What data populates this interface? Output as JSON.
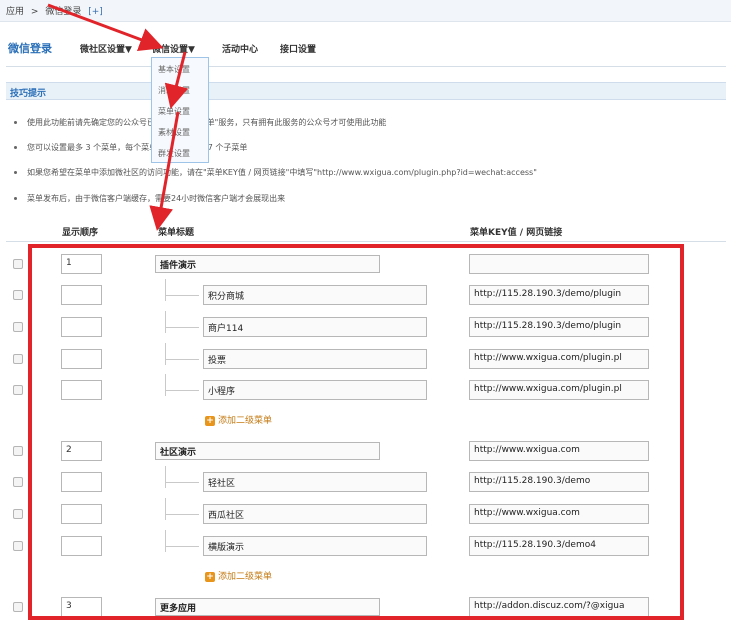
{
  "breadcrumb": {
    "part1": "应用",
    "sep": ">",
    "part2": "微信登录",
    "plus": "[+]"
  },
  "nav": {
    "brand": "微信登录",
    "items": [
      "微社区设置▼",
      "微信设置▼",
      "活动中心",
      "接口设置"
    ]
  },
  "dropdown": {
    "items": [
      "基本设置",
      "消息设置",
      "菜单设置",
      "素材设置",
      "群发设置"
    ]
  },
  "tips": {
    "title": "技巧提示",
    "lines": [
      "使用此功能前请先确定您的公众号已拥有\"自定义菜单\"服务，只有拥有此服务的公众号才可使用此功能",
      "您可以设置最多 3 个菜单，每个菜单可以创建最多 7 个子菜单",
      "如果您希望在菜单中添加微社区的访问功能，请在\"菜单KEY值 / 网页链接\"中填写\"http://www.wxigua.com/plugin.php?id=wechat:access\"",
      "菜单发布后，由于微信客户端缓存，需要24小时微信客户端才会展现出来"
    ]
  },
  "table": {
    "headers": {
      "order": "显示顺序",
      "title": "菜单标题",
      "key": "菜单KEY值 / 网页链接"
    },
    "rows": [
      {
        "type": "main",
        "order": "1",
        "title": "插件演示",
        "key": ""
      },
      {
        "type": "sub",
        "title": "积分商城",
        "key": "http://115.28.190.3/demo/plugin"
      },
      {
        "type": "sub",
        "title": "商户114",
        "key": "http://115.28.190.3/demo/plugin"
      },
      {
        "type": "sub",
        "title": "投票",
        "key": "http://www.wxigua.com/plugin.pl"
      },
      {
        "type": "sub",
        "title": "小程序",
        "key": "http://www.wxigua.com/plugin.pl"
      },
      {
        "type": "add",
        "label": "添加二级菜单"
      },
      {
        "type": "main",
        "order": "2",
        "title": "社区演示",
        "key": "http://www.wxigua.com"
      },
      {
        "type": "sub",
        "title": "轻社区",
        "key": "http://115.28.190.3/demo"
      },
      {
        "type": "sub",
        "title": "西瓜社区",
        "key": "http://www.wxigua.com"
      },
      {
        "type": "sub",
        "title": "横版演示",
        "key": "http://115.28.190.3/demo4"
      },
      {
        "type": "add",
        "label": "添加二级菜单"
      },
      {
        "type": "main",
        "order": "3",
        "title": "更多应用",
        "key": "http://addon.discuz.com/?@xigua"
      }
    ]
  },
  "colors": {
    "accent": "#2a6fb8",
    "highlight": "#e0242a",
    "add": "#e8951c"
  }
}
